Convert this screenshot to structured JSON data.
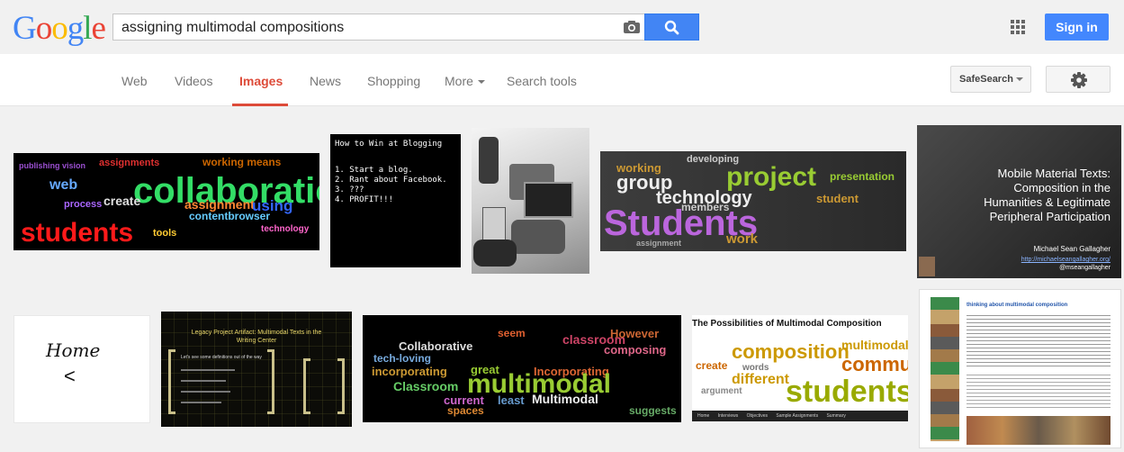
{
  "header": {
    "logo_letters": [
      {
        "ch": "G",
        "color": "#4285f4"
      },
      {
        "ch": "o",
        "color": "#ea4335"
      },
      {
        "ch": "o",
        "color": "#fbbc05"
      },
      {
        "ch": "g",
        "color": "#4285f4"
      },
      {
        "ch": "l",
        "color": "#34a853"
      },
      {
        "ch": "e",
        "color": "#ea4335"
      }
    ],
    "search_query": "assigning multimodal compositions",
    "sign_in_label": "Sign in",
    "camera_icon": "camera-icon",
    "search_icon": "magnifier-icon",
    "apps_icon": "apps-grid-icon"
  },
  "nav": {
    "tabs": [
      "Web",
      "Videos",
      "Images",
      "News",
      "Shopping",
      "More",
      "Search tools"
    ],
    "active_tab": "Images",
    "safesearch_label": "SafeSearch",
    "settings_icon": "gear-icon"
  },
  "colors": {
    "accent_red": "#dd4b39",
    "blue": "#4285f4"
  },
  "results": {
    "blog": {
      "title": "How to Win at Blogging",
      "lines": [
        "1. Start a blog.",
        "2. Rant about Facebook.",
        "3. ???",
        "4. PROFIT!!!"
      ]
    },
    "mobile_texts": {
      "title_lines": [
        "Mobile Material Texts:",
        "Composition in the",
        "Humanities & Legitimate",
        "Peripheral Participation"
      ],
      "author": "Michael Sean Gallagher",
      "url": "http://michaelseangallagher.org/",
      "handle": "@mseangallagher"
    },
    "home": {
      "label": "Home",
      "arrow": "<"
    },
    "legacy": {
      "title_lines": [
        "Legacy Project Artifact: Multimodal Texts in the",
        "Writing Center"
      ],
      "sub": "Let's see some definitions out of the way"
    },
    "possibilities": {
      "title": "The Possibilities of Multimodal Composition",
      "nav_items": [
        "Home",
        "Interviews",
        "Objectives",
        "Sample Assignments",
        "Summary"
      ]
    },
    "thinking": {
      "title": "thinking about multimodal composition"
    }
  }
}
